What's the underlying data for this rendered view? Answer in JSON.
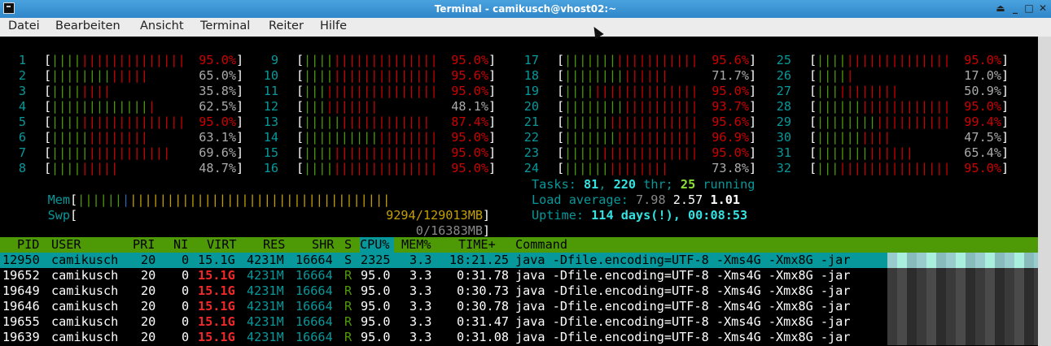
{
  "window": {
    "title": "Terminal - camikusch@vhost02:~"
  },
  "menu": [
    "Datei",
    "Bearbeiten",
    "Ansicht",
    "Terminal",
    "Reiter",
    "Hilfe"
  ],
  "cpus": [
    {
      "n": "1",
      "pct": "95.0%",
      "g": 4,
      "r": 14,
      "red": true
    },
    {
      "n": "2",
      "pct": "65.0%",
      "g": 8,
      "r": 5,
      "red": false
    },
    {
      "n": "3",
      "pct": "35.8%",
      "g": 4,
      "r": 4,
      "red": false
    },
    {
      "n": "4",
      "pct": "62.5%",
      "g": 13,
      "r": 1,
      "red": false
    },
    {
      "n": "5",
      "pct": "95.0%",
      "g": 4,
      "r": 14,
      "red": true
    },
    {
      "n": "6",
      "pct": "63.1%",
      "g": 5,
      "r": 8,
      "red": false
    },
    {
      "n": "7",
      "pct": "69.6%",
      "g": 5,
      "r": 11,
      "red": false
    },
    {
      "n": "8",
      "pct": "48.7%",
      "g": 4,
      "r": 5,
      "red": false
    },
    {
      "n": "9",
      "pct": "95.0%",
      "g": 4,
      "r": 14,
      "red": true
    },
    {
      "n": "10",
      "pct": "95.6%",
      "g": 4,
      "r": 14,
      "red": true
    },
    {
      "n": "11",
      "pct": "95.0%",
      "g": 3,
      "r": 15,
      "red": true
    },
    {
      "n": "12",
      "pct": "48.1%",
      "g": 3,
      "r": 7,
      "red": false
    },
    {
      "n": "13",
      "pct": "87.4%",
      "g": 5,
      "r": 12,
      "red": true
    },
    {
      "n": "14",
      "pct": "95.0%",
      "g": 10,
      "r": 8,
      "red": true
    },
    {
      "n": "15",
      "pct": "95.0%",
      "g": 4,
      "r": 14,
      "red": true
    },
    {
      "n": "16",
      "pct": "95.0%",
      "g": 4,
      "r": 14,
      "red": true
    },
    {
      "n": "17",
      "pct": "95.6%",
      "g": 7,
      "r": 11,
      "red": true
    },
    {
      "n": "18",
      "pct": "71.7%",
      "g": 8,
      "r": 6,
      "red": false
    },
    {
      "n": "19",
      "pct": "95.0%",
      "g": 4,
      "r": 14,
      "red": true
    },
    {
      "n": "20",
      "pct": "93.7%",
      "g": 8,
      "r": 10,
      "red": true
    },
    {
      "n": "21",
      "pct": "95.6%",
      "g": 6,
      "r": 12,
      "red": true
    },
    {
      "n": "22",
      "pct": "96.9%",
      "g": 7,
      "r": 11,
      "red": true
    },
    {
      "n": "23",
      "pct": "95.0%",
      "g": 5,
      "r": 13,
      "red": true
    },
    {
      "n": "24",
      "pct": "73.8%",
      "g": 6,
      "r": 8,
      "red": false
    },
    {
      "n": "25",
      "pct": "95.0%",
      "g": 4,
      "r": 14,
      "red": true
    },
    {
      "n": "26",
      "pct": "17.0%",
      "g": 4,
      "r": 1,
      "red": false
    },
    {
      "n": "27",
      "pct": "50.9%",
      "g": 3,
      "r": 8,
      "red": false
    },
    {
      "n": "28",
      "pct": "95.0%",
      "g": 6,
      "r": 12,
      "red": true
    },
    {
      "n": "29",
      "pct": "99.4%",
      "g": 8,
      "r": 10,
      "red": true
    },
    {
      "n": "30",
      "pct": "47.5%",
      "g": 6,
      "r": 4,
      "red": false
    },
    {
      "n": "31",
      "pct": "65.4%",
      "g": 7,
      "r": 6,
      "red": false
    },
    {
      "n": "32",
      "pct": "95.0%",
      "g": 3,
      "r": 15,
      "red": true
    }
  ],
  "mem": {
    "label": "Mem",
    "value": "9294/129013MB"
  },
  "swp": {
    "label": "Swp",
    "value": "0/16383MB"
  },
  "tasks": {
    "label": "Tasks: ",
    "count": "81",
    "sep1": ", ",
    "thr": "220",
    "thr_label": " thr; ",
    "running": "25",
    "running_label": " running"
  },
  "load": {
    "label": "Load average: ",
    "l1": "7.98",
    "l5": "2.57",
    "l15": "1.01"
  },
  "uptime": {
    "label": "Uptime: ",
    "value": "114 days(!), 00:08:53"
  },
  "columns": [
    "PID",
    "USER",
    "PRI",
    "NI",
    "VIRT",
    "RES",
    "SHR",
    "S",
    "CPU%",
    "MEM%",
    "TIME+",
    "Command"
  ],
  "processes": [
    {
      "pid": "12950",
      "user": "camikusch",
      "pri": "20",
      "ni": "0",
      "virt": "15.1G",
      "res": "4231M",
      "shr": "16664",
      "s": "S",
      "cpu": "2325",
      "mem": "3.3",
      "time": "18:21.25",
      "cmd": "java -Dfile.encoding=UTF-8 -Xms4G -Xmx8G -jar"
    },
    {
      "pid": "19652",
      "user": "camikusch",
      "pri": "20",
      "ni": "0",
      "virt": "15.1G",
      "res": "4231M",
      "shr": "16664",
      "s": "R",
      "cpu": "95.0",
      "mem": "3.3",
      "time": "0:31.78",
      "cmd": "java -Dfile.encoding=UTF-8 -Xms4G -Xmx8G -jar"
    },
    {
      "pid": "19649",
      "user": "camikusch",
      "pri": "20",
      "ni": "0",
      "virt": "15.1G",
      "res": "4231M",
      "shr": "16664",
      "s": "R",
      "cpu": "95.0",
      "mem": "3.3",
      "time": "0:30.73",
      "cmd": "java -Dfile.encoding=UTF-8 -Xms4G -Xmx8G -jar"
    },
    {
      "pid": "19646",
      "user": "camikusch",
      "pri": "20",
      "ni": "0",
      "virt": "15.1G",
      "res": "4231M",
      "shr": "16664",
      "s": "R",
      "cpu": "95.0",
      "mem": "3.3",
      "time": "0:30.78",
      "cmd": "java -Dfile.encoding=UTF-8 -Xms4G -Xmx8G -jar"
    },
    {
      "pid": "19655",
      "user": "camikusch",
      "pri": "20",
      "ni": "0",
      "virt": "15.1G",
      "res": "4231M",
      "shr": "16664",
      "s": "R",
      "cpu": "95.0",
      "mem": "3.3",
      "time": "0:31.47",
      "cmd": "java -Dfile.encoding=UTF-8 -Xms4G -Xmx8G -jar"
    },
    {
      "pid": "19639",
      "user": "camikusch",
      "pri": "20",
      "ni": "0",
      "virt": "15.1G",
      "res": "4231M",
      "shr": "16664",
      "s": "R",
      "cpu": "95.0",
      "mem": "3.3",
      "time": "0:31.08",
      "cmd": "java -Dfile.encoding=UTF-8 -Xms4G -Xmx8G -jar"
    }
  ]
}
